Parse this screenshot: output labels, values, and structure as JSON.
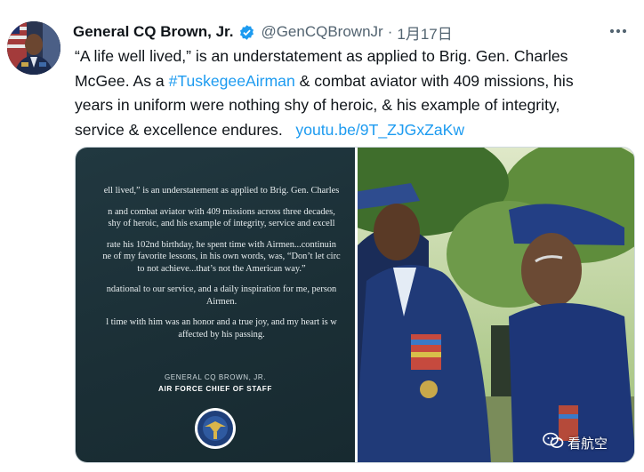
{
  "tweet": {
    "display_name": "General CQ Brown, Jr.",
    "handle": "@GenCQBrownJr",
    "separator": "·",
    "date": "1月17日",
    "text_lines": {
      "l1": "“A life well lived,” is an understatement as applied to Brig. Gen. Charles",
      "l2": "McGee. As a ",
      "l2_hashtag": "#TuskegeeAirman",
      "l2_rest": " & combat aviator with 409 missions, his",
      "l3": "years in uniform were nothing shy of heroic, & his example of integrity,",
      "l4": "service & excellence endures.",
      "l4_link": "youtu.be/9T_ZJGxZaKw"
    },
    "colors": {
      "link": "#1d9bf0",
      "verified": "#1d9bf0",
      "secondary_text": "#536471"
    },
    "icons": {
      "verified": "verified-badge-icon",
      "more": "more-dots-icon"
    }
  },
  "media": {
    "statement": {
      "p1": [
        "ell lived,” is an understatement as applied to Brig. Gen. Charles"
      ],
      "p2": [
        "n and combat aviator with 409 missions across three decades,",
        "shy of heroic, and his example of integrity, service and excell"
      ],
      "p3": [
        "rate his 102nd birthday, he spent time with Airmen...continuin",
        "ne of my favorite lessons, in his own words, was, “Don’t let circ",
        "to not achieve...that’s not the American way.”"
      ],
      "p4": [
        "ndational to our service, and a daily inspiration for me, person",
        "Airmen."
      ],
      "p5": [
        "l time with him was an honor and a true joy, and my heart is w",
        "affected by his passing."
      ],
      "signature_name": "GENERAL CQ BROWN, JR.",
      "signature_title": "AIR FORCE CHIEF OF STAFF"
    },
    "photo": "two-officers-photo"
  },
  "watermark": {
    "text": "看航空"
  }
}
